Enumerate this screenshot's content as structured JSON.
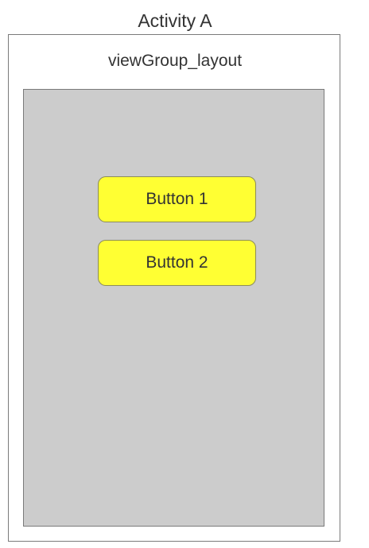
{
  "activity": {
    "title": "Activity A"
  },
  "view_group": {
    "label": "viewGroup_layout"
  },
  "buttons": [
    {
      "label": "Button 1"
    },
    {
      "label": "Button 2"
    }
  ],
  "colors": {
    "button_fill": "#ffff33",
    "view_group_fill": "#cccccc",
    "border": "#7a7a7a",
    "text": "#333333"
  }
}
